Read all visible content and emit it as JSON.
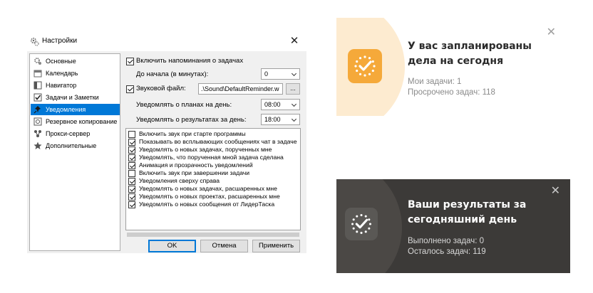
{
  "dialog": {
    "title": "Настройки",
    "nav": [
      {
        "label": "Основные",
        "icon": "gears-icon"
      },
      {
        "label": "Календарь",
        "icon": "calendar-icon"
      },
      {
        "label": "Навигатор",
        "icon": "navigator-icon"
      },
      {
        "label": "Задачи и Заметки",
        "icon": "checkbox-icon"
      },
      {
        "label": "Уведомления",
        "icon": "pin-icon",
        "active": true
      },
      {
        "label": "Резервное копирование",
        "icon": "backup-icon"
      },
      {
        "label": "Прокси-сервер",
        "icon": "network-icon"
      },
      {
        "label": "Дополнительные",
        "icon": "star-icon"
      }
    ],
    "enable_reminders": {
      "label": "Включить напоминания о задачах",
      "checked": true
    },
    "before_start": {
      "label": "До начала (в минутах):",
      "value": "0"
    },
    "sound_file": {
      "label": "Звуковой файл:",
      "checked": true,
      "value": ".\\Sound\\DefaultReminder.w",
      "browse": "..."
    },
    "plans_notify": {
      "label": "Уведомлять о планах на день:",
      "value": "08:00"
    },
    "results_notify": {
      "label": "Уведомлять о результатах за день:",
      "value": "18:00"
    },
    "options": [
      {
        "label": "Включить звук при старте программы",
        "checked": false
      },
      {
        "label": "Показывать во всплывающих сообщениях чат в задаче",
        "checked": true
      },
      {
        "label": "Уведомлять о новых задачах, порученных мне",
        "checked": true
      },
      {
        "label": "Уведомлять, что порученная мной задача сделана",
        "checked": true
      },
      {
        "label": "Анимация и прозрачность уведомлений",
        "checked": true
      },
      {
        "label": "Включить звук при завершении задачи",
        "checked": false
      },
      {
        "label": "Уведомления сверху справа",
        "checked": true
      },
      {
        "label": "Уведомлять о новых задачах, расшаренных мне",
        "checked": true
      },
      {
        "label": "Уведомлять о новых проектах, расшаренных мне",
        "checked": true
      },
      {
        "label": "Уведомлять о новых сообщения от ЛидерТаска",
        "checked": true
      }
    ],
    "buttons": {
      "ok": "OK",
      "cancel": "Отмена",
      "apply": "Применить"
    }
  },
  "toast_plan": {
    "title": "У вас запланированы дела на сегодня",
    "lines": [
      "Мои задачи: 1",
      "Просрочено задач: 118"
    ],
    "accent": "#f5a93a"
  },
  "toast_results": {
    "title": "Ваши результаты за сегодняшний день",
    "lines": [
      "Выполнено задач: 0",
      "Осталось задач: 119"
    ],
    "background": "#3c3a38"
  }
}
